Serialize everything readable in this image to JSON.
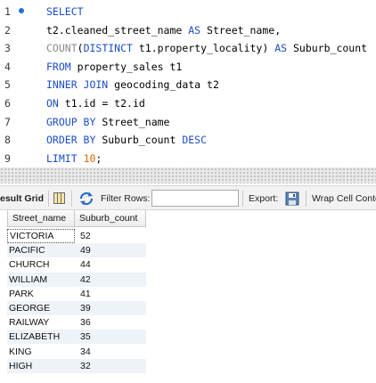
{
  "editor": {
    "lines": [
      {
        "n": "1",
        "tokens": [
          {
            "t": "kw",
            "v": "SELECT"
          }
        ]
      },
      {
        "n": "2",
        "tokens": [
          {
            "t": "txt",
            "v": "t2.cleaned_street_name "
          },
          {
            "t": "kw",
            "v": "AS"
          },
          {
            "t": "txt",
            "v": " Street_name,"
          }
        ]
      },
      {
        "n": "3",
        "tokens": [
          {
            "t": "fn",
            "v": "COUNT"
          },
          {
            "t": "txt",
            "v": "("
          },
          {
            "t": "kw",
            "v": "DISTINCT"
          },
          {
            "t": "txt",
            "v": " t1.property_locality) "
          },
          {
            "t": "kw",
            "v": "AS"
          },
          {
            "t": "txt",
            "v": " Suburb_count"
          }
        ]
      },
      {
        "n": "4",
        "tokens": [
          {
            "t": "kw",
            "v": "FROM"
          },
          {
            "t": "txt",
            "v": " property_sales t1"
          }
        ]
      },
      {
        "n": "5",
        "tokens": [
          {
            "t": "kw",
            "v": "INNER JOIN"
          },
          {
            "t": "txt",
            "v": " geocoding_data t2"
          }
        ]
      },
      {
        "n": "6",
        "tokens": [
          {
            "t": "kw",
            "v": "ON"
          },
          {
            "t": "txt",
            "v": " t1.id = t2.id"
          }
        ]
      },
      {
        "n": "7",
        "tokens": [
          {
            "t": "kw",
            "v": "GROUP BY"
          },
          {
            "t": "txt",
            "v": " Street_name"
          }
        ]
      },
      {
        "n": "8",
        "tokens": [
          {
            "t": "kw",
            "v": "ORDER BY"
          },
          {
            "t": "txt",
            "v": " Suburb_count "
          },
          {
            "t": "kw",
            "v": "DESC"
          }
        ]
      },
      {
        "n": "9",
        "tokens": [
          {
            "t": "kw",
            "v": "LIMIT"
          },
          {
            "t": "txt",
            "v": " "
          },
          {
            "t": "num",
            "v": "10"
          },
          {
            "t": "txt",
            "v": ";"
          }
        ]
      }
    ]
  },
  "toolbar": {
    "result_grid_label": "esult Grid",
    "filter_label": "Filter Rows:",
    "filter_value": "",
    "export_label": "Export:",
    "wrap_label": "Wrap Cell Conte"
  },
  "grid": {
    "columns": [
      "Street_name",
      "Suburb_count"
    ],
    "rows": [
      [
        "VICTORIA",
        "52"
      ],
      [
        "PACIFIC",
        "49"
      ],
      [
        "CHURCH",
        "44"
      ],
      [
        "WILLIAM",
        "42"
      ],
      [
        "PARK",
        "41"
      ],
      [
        "GEORGE",
        "39"
      ],
      [
        "RAILWAY",
        "36"
      ],
      [
        "ELIZABETH",
        "35"
      ],
      [
        "KING",
        "34"
      ],
      [
        "HIGH",
        "32"
      ]
    ]
  },
  "colors": {
    "keyword": "#1b4dc9",
    "function": "#8a8a8a",
    "number": "#d96a00",
    "alt_row": "#eef3f8"
  },
  "icons": {
    "result_grid": "grid-icon",
    "refresh": "refresh-icon",
    "export": "save-icon"
  }
}
